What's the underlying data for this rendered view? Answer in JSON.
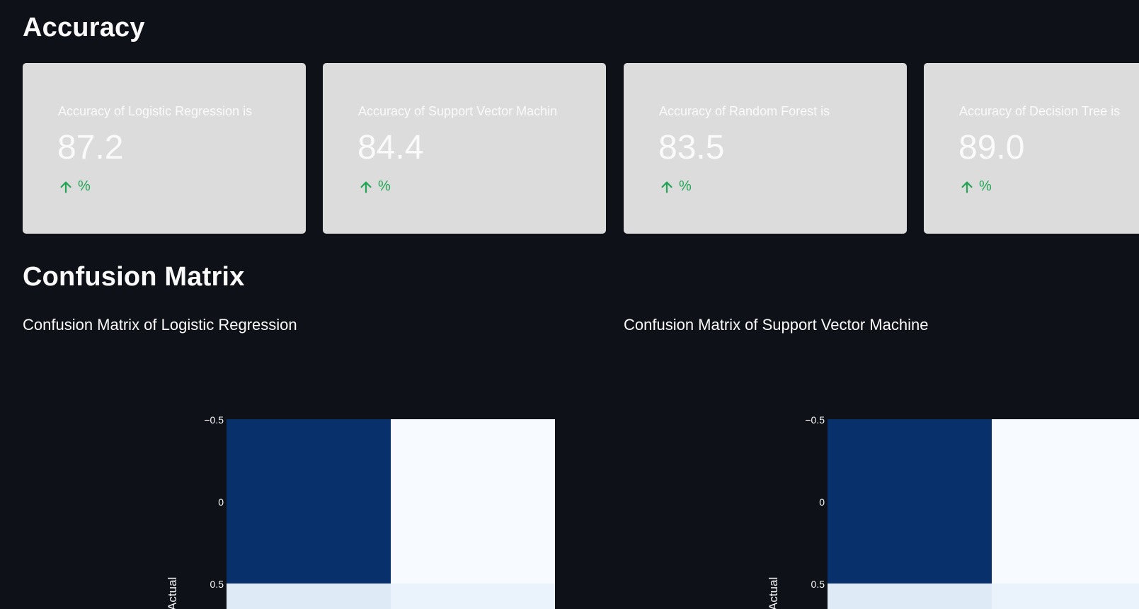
{
  "sections": {
    "accuracy_title": "Accuracy",
    "confusion_title": "Confusion Matrix"
  },
  "metrics": [
    {
      "label": "Accuracy of Logistic Regression is",
      "value": "87.2",
      "delta": "%"
    },
    {
      "label": "Accuracy of Support Vector Machin",
      "value": "84.4",
      "delta": "%"
    },
    {
      "label": "Accuracy of Random Forest is",
      "value": "83.5",
      "delta": "%"
    },
    {
      "label": "Accuracy of Decision Tree is",
      "value": "89.0",
      "delta": "%"
    }
  ],
  "confusion": [
    {
      "subtitle": "Confusion Matrix of Logistic Regression",
      "y_axis_label": "Actual",
      "y_ticks": [
        "−0.5",
        "0",
        "0.5"
      ]
    },
    {
      "subtitle": "Confusion Matrix of Support Vector Machine",
      "y_axis_label": "Actual",
      "y_ticks": [
        "−0.5",
        "0",
        "0.5"
      ]
    }
  ],
  "colors": {
    "background": "#0e1117",
    "card": "#dcdcdc",
    "delta_up": "#21a453",
    "heat_dark": "#08306b",
    "heat_light": "#f7fbff",
    "heat_pale": "#deebf7"
  },
  "icons": {
    "delta": "arrow-up-icon"
  }
}
